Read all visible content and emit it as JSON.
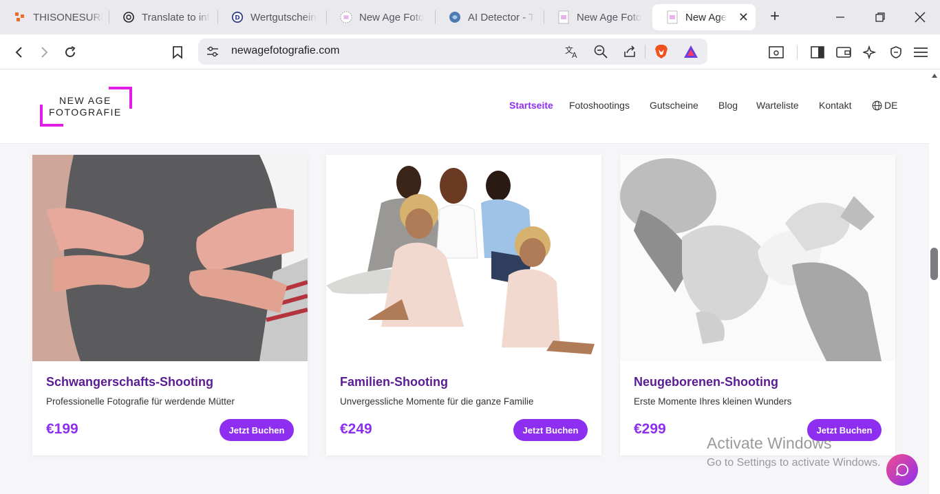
{
  "browser": {
    "tabs": [
      {
        "label": "THISONESURE",
        "icon": "app-grid-icon"
      },
      {
        "label": "Translate to inf",
        "icon": "chatgpt-icon"
      },
      {
        "label": "Wertgutschein",
        "icon": "d-logo-icon"
      },
      {
        "label": "New Age Foto",
        "icon": "site-favicon-icon"
      },
      {
        "label": "AI Detector - T",
        "icon": "brain-icon"
      },
      {
        "label": "New Age Foto",
        "icon": "site-favicon-icon"
      },
      {
        "label": "New Age",
        "icon": "site-favicon-icon",
        "active": true
      }
    ],
    "new_tab": "+",
    "url": "newagefotografie.com"
  },
  "site": {
    "logo_line1": "NEW AGE",
    "logo_line2": "FOTOGRAFIE",
    "nav": [
      "Startseite",
      "Fotoshootings",
      "Gutscheine",
      "Blog",
      "Warteliste",
      "Kontakt"
    ],
    "lang": "DE",
    "accent": "#8d2ef0",
    "brand_pink": "#e11ee6"
  },
  "cards": [
    {
      "title": "Schwangerschafts-Shooting",
      "desc": "Professionelle Fotografie für werdende Mütter",
      "price": "€199",
      "button": "Jetzt Buchen"
    },
    {
      "title": "Familien-Shooting",
      "desc": "Unvergessliche Momente für die ganze Familie",
      "price": "€249",
      "button": "Jetzt Buchen"
    },
    {
      "title": "Neugeborenen-Shooting",
      "desc": "Erste Momente Ihres kleinen Wunders",
      "price": "€299",
      "button": "Jetzt Buchen"
    }
  ],
  "watermark": {
    "line1": "Activate Windows",
    "line2": "Go to Settings to activate Windows."
  }
}
